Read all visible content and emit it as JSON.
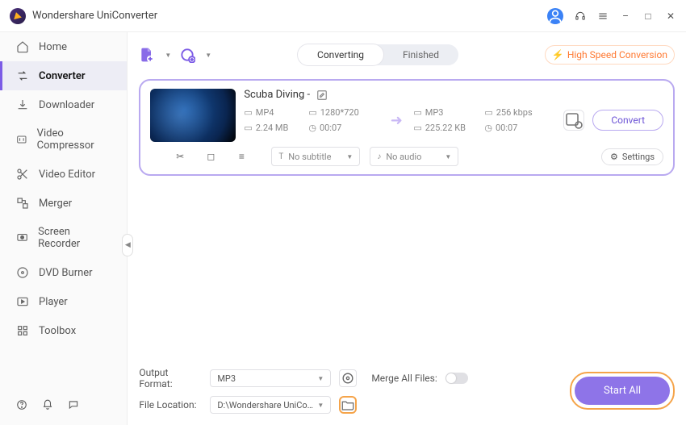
{
  "app": {
    "title": "Wondershare UniConverter"
  },
  "window": {
    "minimize": "–",
    "maximize": "□",
    "close": "✕"
  },
  "sidebar": {
    "items": [
      {
        "label": "Home",
        "icon": "home-icon"
      },
      {
        "label": "Converter",
        "icon": "converter-icon"
      },
      {
        "label": "Downloader",
        "icon": "download-icon"
      },
      {
        "label": "Video Compressor",
        "icon": "compress-icon"
      },
      {
        "label": "Video Editor",
        "icon": "scissors-icon"
      },
      {
        "label": "Merger",
        "icon": "merge-icon"
      },
      {
        "label": "Screen Recorder",
        "icon": "record-icon"
      },
      {
        "label": "DVD Burner",
        "icon": "disc-icon"
      },
      {
        "label": "Player",
        "icon": "play-icon"
      },
      {
        "label": "Toolbox",
        "icon": "grid-icon"
      }
    ],
    "active_index": 1
  },
  "tabs": {
    "converting": "Converting",
    "finished": "Finished",
    "active": "converting"
  },
  "high_speed": "High Speed Conversion",
  "file": {
    "title": "Scuba Diving -",
    "src": {
      "format": "MP4",
      "resolution": "1280*720",
      "size": "2.24 MB",
      "duration": "00:07"
    },
    "dst": {
      "format": "MP3",
      "bitrate": "256 kbps",
      "size": "225.22 KB",
      "duration": "00:07"
    },
    "subtitle": "No subtitle",
    "audio": "No audio",
    "settings": "Settings",
    "convert": "Convert"
  },
  "bottom": {
    "output_format_label": "Output Format:",
    "output_format_value": "MP3",
    "file_location_label": "File Location:",
    "file_location_value": "D:\\Wondershare UniConverter",
    "merge_label": "Merge All Files:",
    "start": "Start All"
  }
}
